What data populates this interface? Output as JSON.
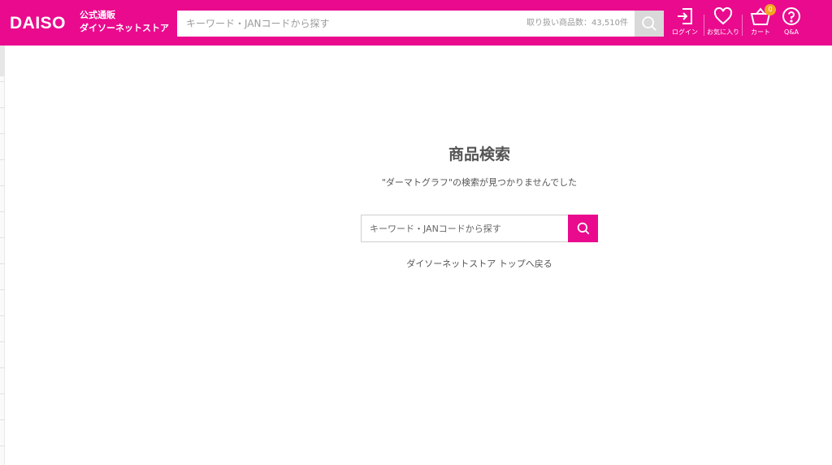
{
  "header": {
    "logo_word": "DAISO",
    "logo_sub_line1": "公式通販",
    "logo_sub_line2": "ダイソーネットストア",
    "search": {
      "placeholder": "キーワード・JANコードから探す",
      "value": "",
      "count_text": "取り扱い商品数：43,510件"
    },
    "nav": {
      "login": "ログイン",
      "favorites": "お気に入り",
      "cart": "カート",
      "cart_count": "0",
      "qa": "Q&A"
    }
  },
  "main": {
    "title": "商品検索",
    "message": "\"ダーマトグラフ\"の検索が見つかりませんでした",
    "search": {
      "placeholder": "キーワード・JANコードから探す",
      "value": ""
    },
    "top_link": "ダイソーネットストア トップへ戻る"
  },
  "colors": {
    "brand": "#ea0a8e",
    "badge": "#f5a623"
  },
  "icons": [
    "search-icon",
    "login-icon",
    "heart-icon",
    "cart-icon",
    "question-icon"
  ]
}
